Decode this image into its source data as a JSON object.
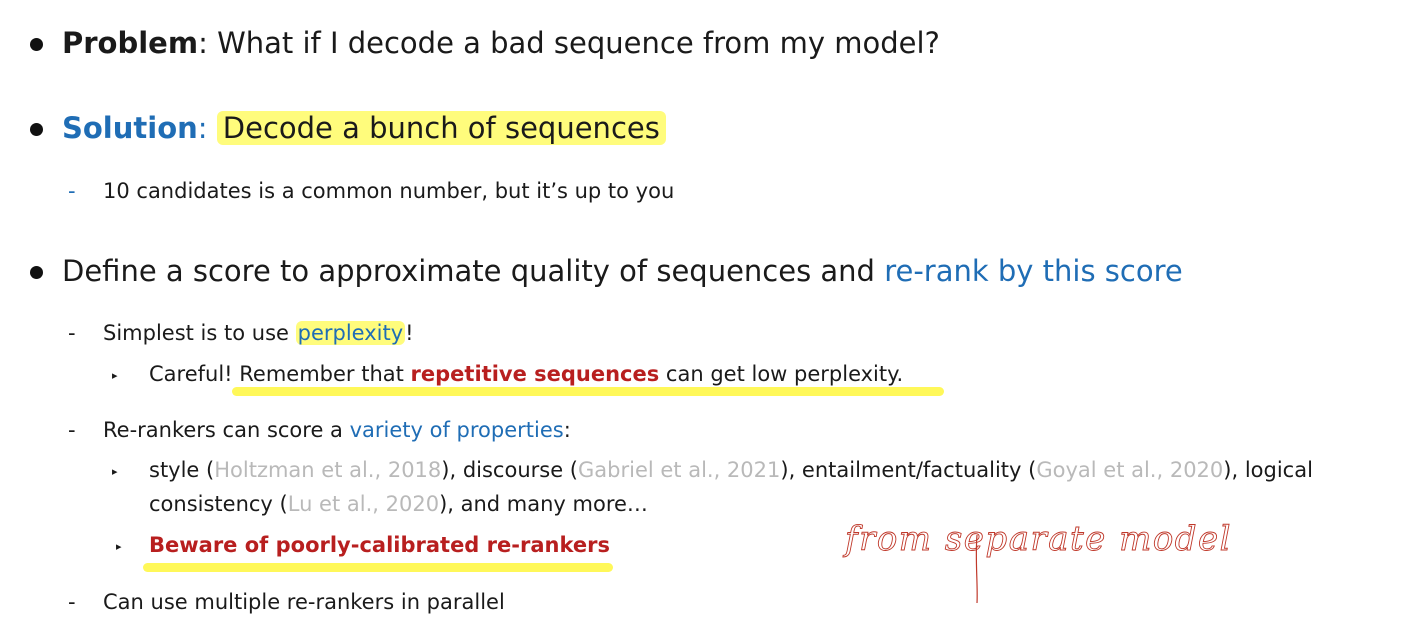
{
  "problem": {
    "label": "Problem",
    "text": ": What if I decode a bad sequence from my model?"
  },
  "solution": {
    "label": "Solution",
    "colon": ": ",
    "text": "Decode a bunch of sequences",
    "sub": "10 candidates is a common number, but it’s up to you"
  },
  "define": {
    "text": "Define a score to approximate quality of sequences and ",
    "link": "re-rank by this score"
  },
  "simplest": {
    "prefix": "Simplest is to use ",
    "link": "perplexity",
    "suffix": "!"
  },
  "careful": {
    "prefix": "Careful! Remember that ",
    "emph": "repetitive sequences",
    "suffix": " can get low perplexity."
  },
  "rerankers": {
    "prefix": "Re-rankers can score a ",
    "link": "variety of properties",
    "suffix": ":"
  },
  "style": {
    "t1": "style (",
    "c1": "Holtzman et al., 2018",
    "t2": "), discourse (",
    "c2": "Gabriel et al., 2021",
    "t3": "), entailment/factuality (",
    "c3": "Goyal et al., 2020",
    "t4": "), logical",
    "t5": "consistency (",
    "c4": "Lu et al., 2020",
    "t6": "), and many more…"
  },
  "beware": "Beware of poorly-calibrated re-rankers",
  "multiple": "Can use multiple re-rankers in parallel",
  "annotation": "from separate model",
  "colors": {
    "blue": "#1f6db5",
    "red": "#b81f1f",
    "highlight": "#fff74a",
    "grey_citation": "#b9b9b9"
  }
}
